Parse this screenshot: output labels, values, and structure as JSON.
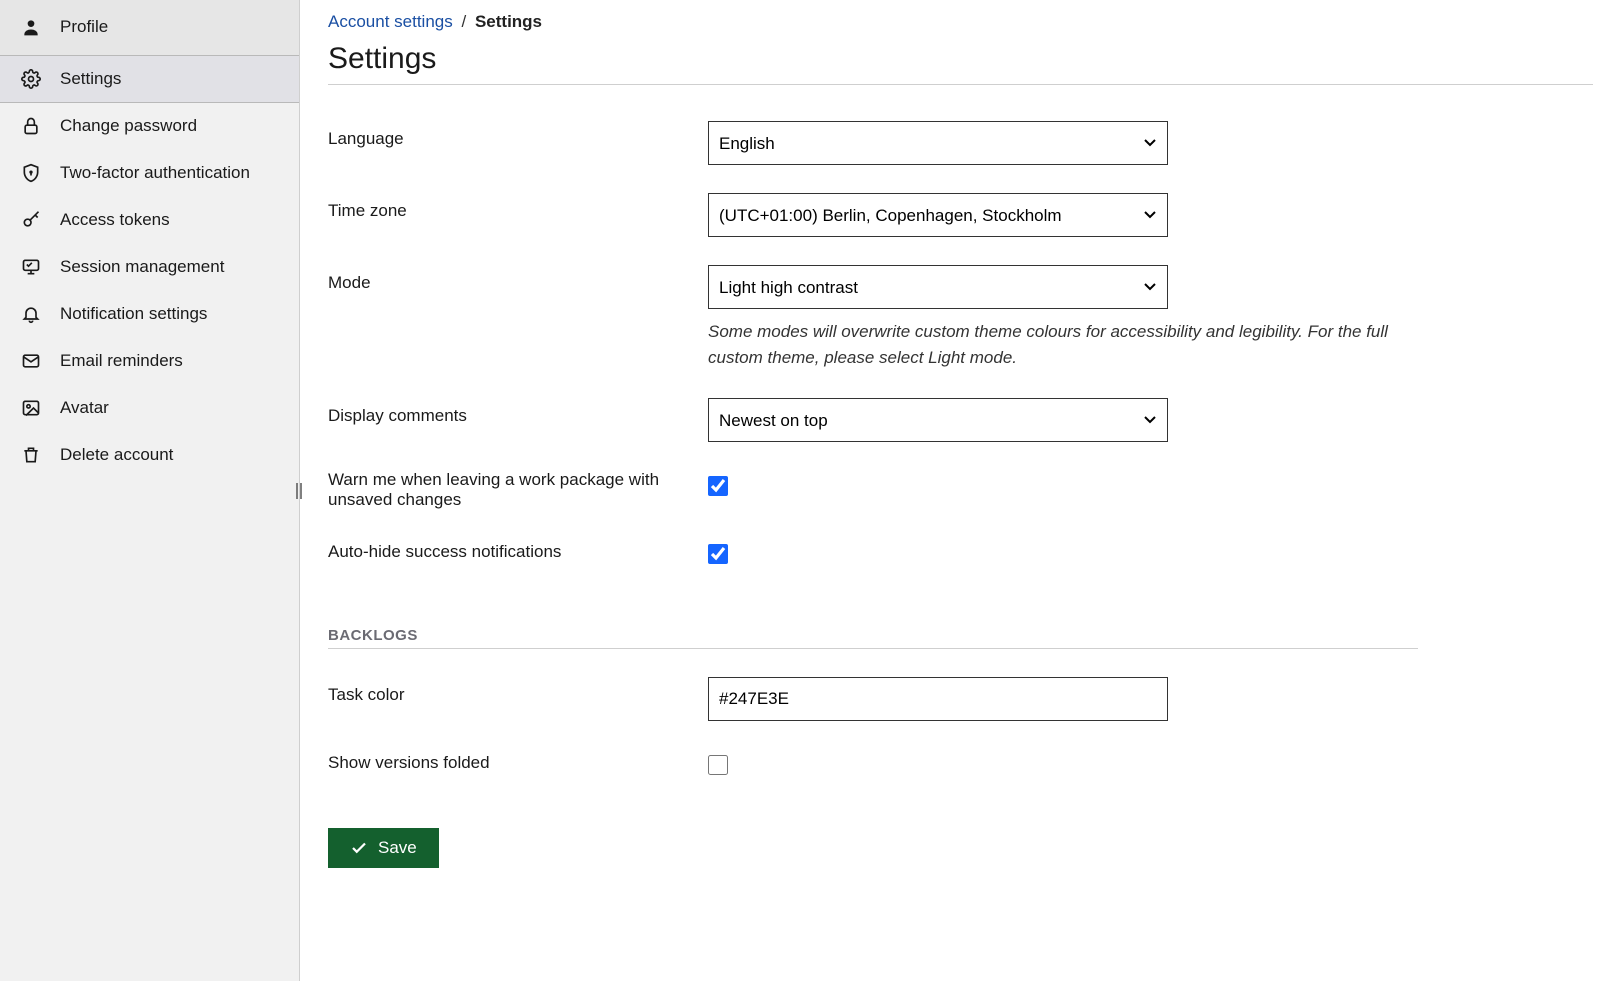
{
  "sidebar": {
    "items": [
      {
        "label": "Profile",
        "icon": "user-icon"
      },
      {
        "label": "Settings",
        "icon": "gear-icon",
        "active": true
      },
      {
        "label": "Change password",
        "icon": "lock-icon"
      },
      {
        "label": "Two-factor authentication",
        "icon": "shield-icon"
      },
      {
        "label": "Access tokens",
        "icon": "key-icon"
      },
      {
        "label": "Session management",
        "icon": "monitor-icon"
      },
      {
        "label": "Notification settings",
        "icon": "bell-icon"
      },
      {
        "label": "Email reminders",
        "icon": "mail-icon"
      },
      {
        "label": "Avatar",
        "icon": "image-icon"
      },
      {
        "label": "Delete account",
        "icon": "trash-icon"
      }
    ]
  },
  "breadcrumb": {
    "parent": "Account settings",
    "separator": "/",
    "current": "Settings"
  },
  "page": {
    "title": "Settings"
  },
  "form": {
    "language": {
      "label": "Language",
      "value": "English"
    },
    "timezone": {
      "label": "Time zone",
      "value": "(UTC+01:00) Berlin, Copenhagen, Stockholm"
    },
    "mode": {
      "label": "Mode",
      "value": "Light high contrast",
      "hint": "Some modes will overwrite custom theme colours for accessibility and legibility. For the full custom theme, please select Light mode."
    },
    "display_comments": {
      "label": "Display comments",
      "value": "Newest on top"
    },
    "warn_unsaved": {
      "label": "Warn me when leaving a work package with unsaved changes",
      "checked": true
    },
    "auto_hide": {
      "label": "Auto-hide success notifications",
      "checked": true
    },
    "backlogs_heading": "BACKLOGS",
    "task_color": {
      "label": "Task color",
      "value": "#247E3E"
    },
    "show_versions_folded": {
      "label": "Show versions folded",
      "checked": false
    },
    "save_label": "Save"
  },
  "colors": {
    "link": "#1a4fa3",
    "save_button": "#14602e",
    "checkbox_accent": "#1565ff"
  }
}
